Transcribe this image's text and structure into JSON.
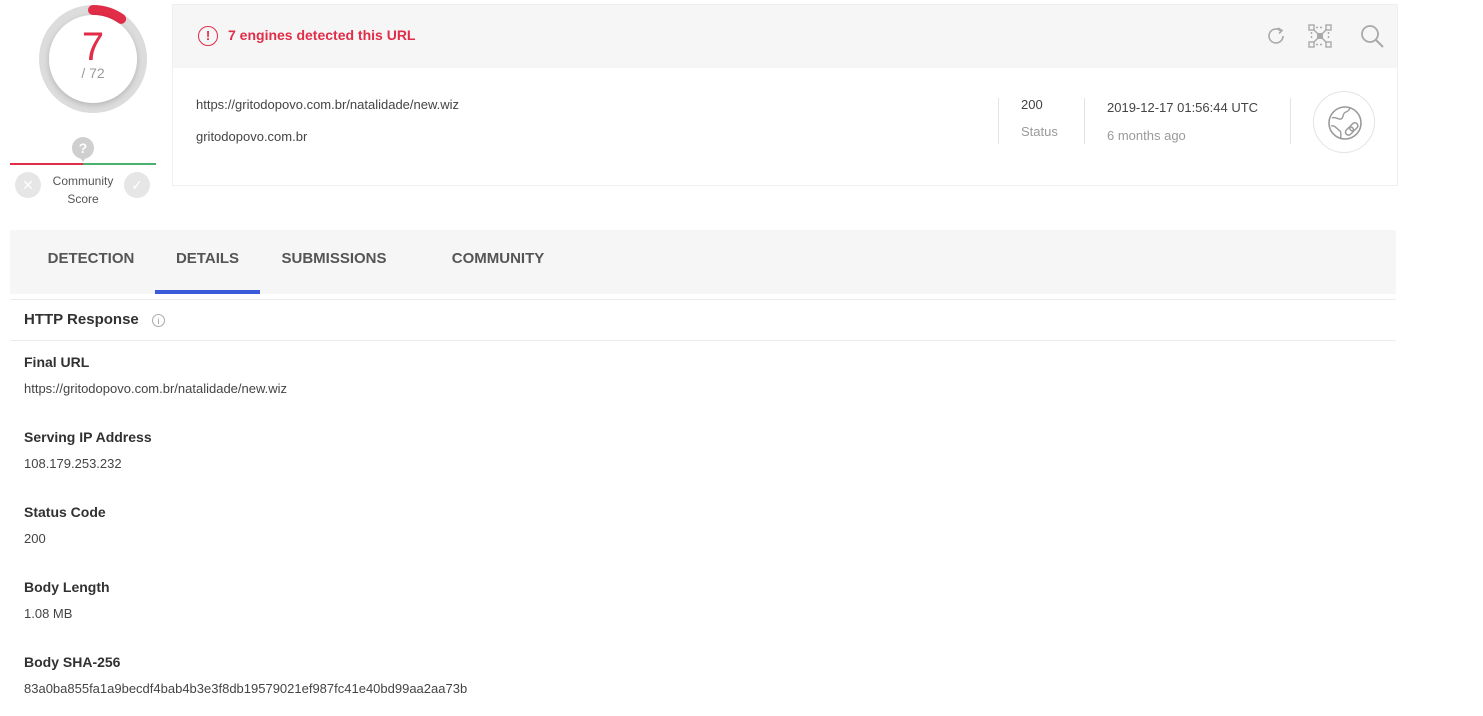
{
  "score": {
    "detected": "7",
    "total": "/ 72",
    "detection_ratio": 0.0972,
    "community_pin": "?",
    "community_label_line1": "Community",
    "community_label_line2": "Score",
    "vote_down_glyph": "✕",
    "vote_up_glyph": "✓"
  },
  "alert": {
    "icon": "!",
    "text": "7 engines detected this URL"
  },
  "toolbar": {
    "refresh_icon": "refresh-icon",
    "graph_icon": "graph-icon",
    "search_icon": "search-icon"
  },
  "url_info": {
    "full_url": "https://gritodopovo.com.br/natalidade/new.wiz",
    "domain": "gritodopovo.com.br",
    "status_value": "200",
    "status_label": "Status",
    "date": "2019-12-17 01:56:44 UTC",
    "date_relative": "6 months ago",
    "thumbnail_icon": "globe-link-icon"
  },
  "tabs": [
    {
      "label": "DETECTION",
      "active": false
    },
    {
      "label": "DETAILS",
      "active": true
    },
    {
      "label": "SUBMISSIONS",
      "active": false
    },
    {
      "label": "COMMUNITY",
      "active": false
    }
  ],
  "details": {
    "section_title": "HTTP Response",
    "info_glyph": "i",
    "fields": [
      {
        "label": "Final URL",
        "value": "https://gritodopovo.com.br/natalidade/new.wiz"
      },
      {
        "label": "Serving IP Address",
        "value": "108.179.253.232"
      },
      {
        "label": "Status Code",
        "value": "200"
      },
      {
        "label": "Body Length",
        "value": "1.08 MB"
      },
      {
        "label": "Body SHA-256",
        "value": "83a0ba855fa1a9becdf4bab4b3e3f8db19579021ef987fc41e40bd99aa2aa73b"
      }
    ]
  },
  "colors": {
    "malicious": "#e12d47",
    "accent_tab": "#3b5bdb",
    "harmless": "#4caf6e"
  }
}
